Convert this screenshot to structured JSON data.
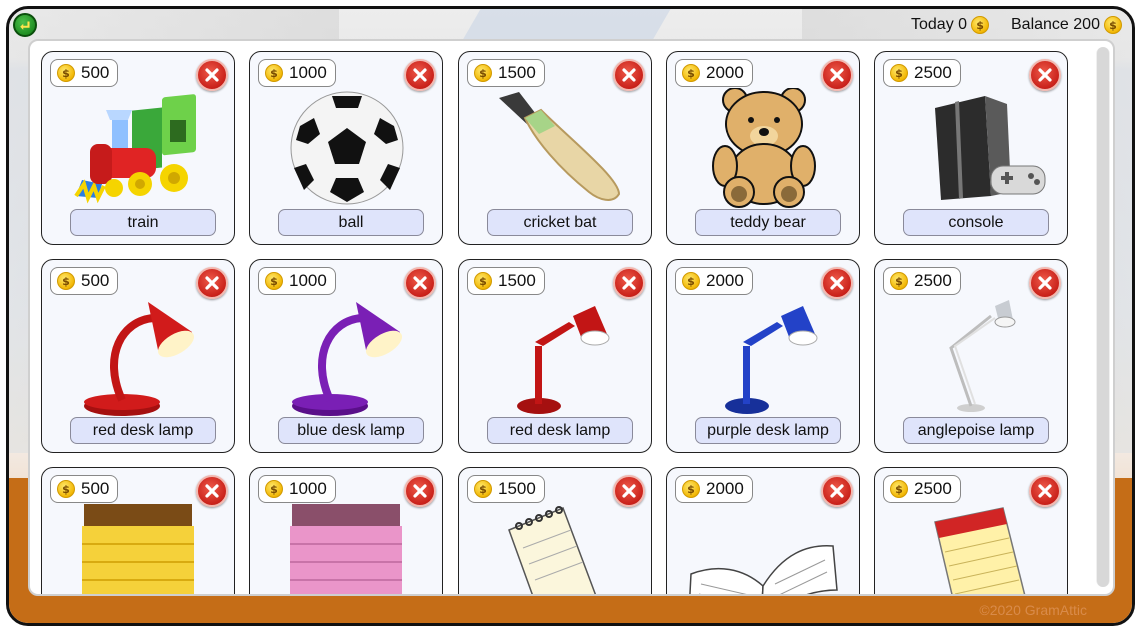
{
  "top_bar": {
    "today_label": "Today 0",
    "balance_label": "Balance 200",
    "coin_symbol": "$"
  },
  "items": [
    {
      "price": "500",
      "name": "train",
      "icon": "train-icon"
    },
    {
      "price": "1000",
      "name": "ball",
      "icon": "soccer-ball-icon"
    },
    {
      "price": "1500",
      "name": "cricket bat",
      "icon": "cricket-bat-icon"
    },
    {
      "price": "2000",
      "name": "teddy bear",
      "icon": "teddy-bear-icon"
    },
    {
      "price": "2500",
      "name": "console",
      "icon": "game-console-icon"
    },
    {
      "price": "500",
      "name": "red desk lamp",
      "icon": "red-desk-lamp-icon"
    },
    {
      "price": "1000",
      "name": "blue desk lamp",
      "icon": "purple-desk-lamp-icon"
    },
    {
      "price": "1500",
      "name": "red desk lamp",
      "icon": "red-arm-lamp-icon"
    },
    {
      "price": "2000",
      "name": "purple desk lamp",
      "icon": "blue-arm-lamp-icon"
    },
    {
      "price": "2500",
      "name": "anglepoise lamp",
      "icon": "anglepoise-lamp-icon"
    },
    {
      "price": "500",
      "name": "",
      "icon": "yellow-notepad-icon"
    },
    {
      "price": "1000",
      "name": "",
      "icon": "pink-notepad-icon"
    },
    {
      "price": "1500",
      "name": "",
      "icon": "spiral-notepad-icon"
    },
    {
      "price": "2000",
      "name": "",
      "icon": "open-book-icon"
    },
    {
      "price": "2500",
      "name": "",
      "icon": "legal-pad-icon"
    }
  ],
  "footer": {
    "copyright": "©2020 GramAttic"
  },
  "colors": {
    "floor": "#c56d17",
    "card_bg": "#f6f8fd",
    "label_bg": "#dfe4fb",
    "delete_red": "#c9211a",
    "coin_gold": "#f2b705"
  }
}
